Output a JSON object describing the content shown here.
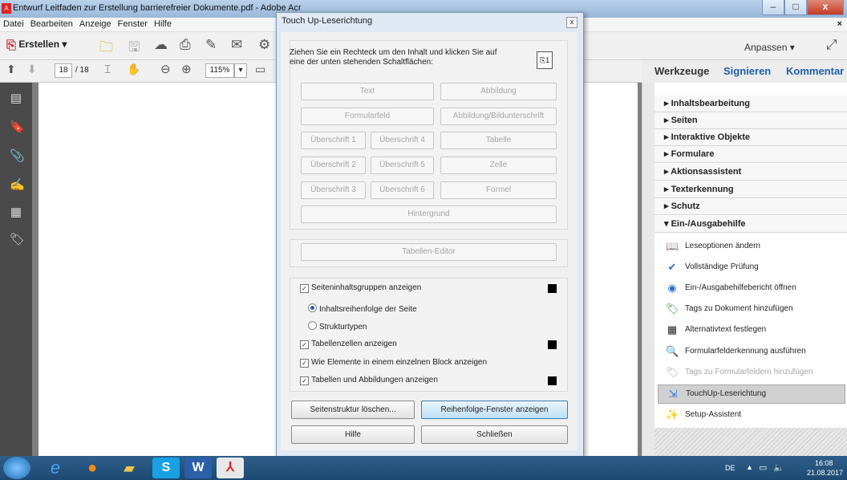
{
  "window": {
    "title": "Entwurf Leitfaden zur Erstellung barrierefreier Dokumente.pdf - Adobe Acr",
    "controls": {
      "minimize": "–",
      "maximize": "□",
      "close": "x"
    }
  },
  "menubar": {
    "items": [
      "Datei",
      "Bearbeiten",
      "Anzeige",
      "Fenster",
      "Hilfe"
    ],
    "close": "×"
  },
  "toolbar": {
    "create_label": "Erstellen ▾",
    "customize_label": "Anpassen ▾",
    "page_current": "18",
    "page_total": "/ 18",
    "zoom": "115%"
  },
  "right_pane": {
    "tabs": [
      "Werkzeuge",
      "Signieren",
      "Kommentar"
    ],
    "sections": [
      "Inhaltsbearbeitung",
      "Seiten",
      "Interaktive Objekte",
      "Formulare",
      "Aktionsassistent",
      "Texterkennung",
      "Schutz",
      "Ein-/Ausgabehilfe"
    ],
    "tools": [
      {
        "label": "Leseoptionen ändern",
        "icon": "book-icon"
      },
      {
        "label": "Vollständige Prüfung",
        "icon": "check-shield-icon"
      },
      {
        "label": "Ein-/Ausgabehilfebericht öffnen",
        "icon": "report-icon"
      },
      {
        "label": "Tags zu Dokument hinzufügen",
        "icon": "tag-icon"
      },
      {
        "label": "Alternativtext festlegen",
        "icon": "alt-text-icon"
      },
      {
        "label": "Formularfelderkennung ausführen",
        "icon": "form-detect-icon"
      },
      {
        "label": "Tags zu Formularfeldern hinzufügen",
        "icon": "form-tag-icon",
        "disabled": true
      },
      {
        "label": "TouchUp-Leserichtung",
        "icon": "touchup-icon",
        "selected": true
      },
      {
        "label": "Setup-Assistent",
        "icon": "wand-icon"
      }
    ]
  },
  "dialog": {
    "title": "Touch Up-Leserichtung",
    "close": "x",
    "instruction": "Ziehen Sie ein Rechteck um den Inhalt und klicken Sie auf eine der unten stehenden Schaltflächen:",
    "buttons": {
      "text": "Text",
      "figure": "Abbildung",
      "form_field": "Formularfeld",
      "figure_caption": "Abbildung/Bildunterschrift",
      "h1": "Überschrift 1",
      "h2": "Überschrift 2",
      "h3": "Überschrift 3",
      "h4": "Überschrift 4",
      "h5": "Überschrift 5",
      "h6": "Überschrift 6",
      "table": "Tabelle",
      "cell": "Zelle",
      "formula": "Formel",
      "background": "Hintergrund",
      "table_editor": "Tabellen-Editor"
    },
    "options": {
      "show_content_groups": "Seiteninhaltsgruppen anzeigen",
      "page_content_order": "Inhaltsreihenfolge der Seite",
      "structure_types": "Strukturtypen",
      "show_table_cells": "Tabellenzellen anzeigen",
      "show_single_block": "Wie Elemente in einem einzelnen Block anzeigen",
      "show_tables_figures": "Tabellen und Abbildungen anzeigen"
    },
    "actions": {
      "clear_structure": "Seitenstruktur löschen...",
      "show_order_panel": "Reihenfolge-Fenster anzeigen",
      "help": "Hilfe",
      "close": "Schließen"
    }
  },
  "taskbar": {
    "apps": [
      "ie-icon",
      "firefox-icon",
      "explorer-icon",
      "skype-icon",
      "word-icon",
      "acrobat-icon"
    ],
    "tray": {
      "lang": "DE",
      "time": "16:08",
      "date": "21.08.2017"
    }
  },
  "colors": {
    "swatch": "#000000",
    "accent": "#1f5fa8"
  }
}
